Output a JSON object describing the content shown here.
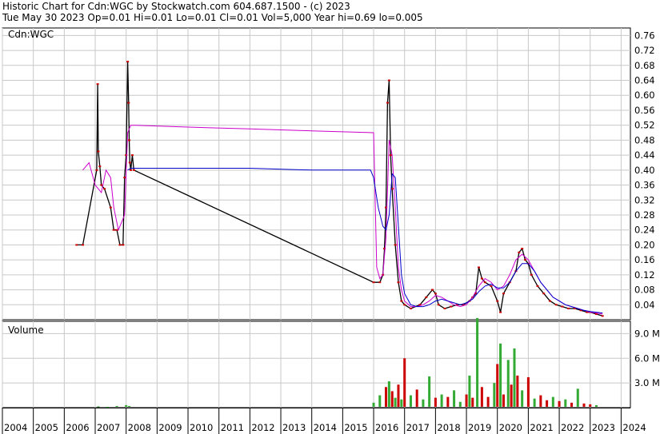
{
  "header": {
    "line1": "Historic Chart for Cdn:WGC by Stockwatch.com 604.687.1500 - (c) 2023",
    "line2": "Tue May 30 2023  Op=0.01  Hi=0.01  Lo=0.01  Cl=0.01  Vol=5,000  Year hi=0.69  lo=0.005"
  },
  "colors": {
    "price": "#000000",
    "price_marker": "#cc0000",
    "ma_short": "#cc00cc",
    "ma_long": "#0000cc",
    "volume_up": "#33aa33",
    "volume_down": "#cc0000",
    "grid": "#c8c8c8"
  },
  "chart_data": [
    {
      "type": "line",
      "symbol_label": "Cdn:WGC",
      "y_ticks": [
        "0.76",
        "0.72",
        "0.68",
        "0.64",
        "0.60",
        "0.56",
        "0.52",
        "0.48",
        "0.44",
        "0.40",
        "0.36",
        "0.32",
        "0.28",
        "0.24",
        "0.20",
        "0.16",
        "0.12",
        "0.08",
        "0.04"
      ],
      "ylim": [
        0,
        0.78
      ],
      "x_ticks": [
        "2004",
        "2005",
        "2006",
        "2007",
        "2008",
        "2009",
        "2010",
        "2011",
        "2012",
        "2013",
        "2014",
        "2015",
        "2016",
        "2017",
        "2018",
        "2019",
        "2020",
        "2021",
        "2022",
        "2023",
        "2024"
      ],
      "xlim": [
        2004.0,
        2024.3
      ],
      "grid": true,
      "series": [
        {
          "key": "price",
          "x": [
            2006.4,
            2006.6,
            2007.05,
            2007.08,
            2007.1,
            2007.15,
            2007.2,
            2007.3,
            2007.5,
            2007.6,
            2007.7,
            2007.8,
            2007.9,
            2007.95,
            2008.0,
            2008.05,
            2008.08,
            2008.1,
            2008.12,
            2008.15,
            2008.2,
            2008.25,
            2016.0,
            2016.2,
            2016.3,
            2016.35,
            2016.4,
            2016.45,
            2016.5,
            2016.55,
            2016.6,
            2016.7,
            2016.8,
            2016.9,
            2017.0,
            2017.2,
            2017.5,
            2017.7,
            2017.9,
            2018.0,
            2018.1,
            2018.3,
            2018.5,
            2018.7,
            2018.9,
            2019.1,
            2019.2,
            2019.3,
            2019.4,
            2019.5,
            2019.6,
            2019.8,
            2020.0,
            2020.1,
            2020.2,
            2020.4,
            2020.6,
            2020.7,
            2020.8,
            2020.9,
            2021.0,
            2021.1,
            2021.3,
            2021.5,
            2021.7,
            2021.9,
            2022.1,
            2022.3,
            2022.5,
            2022.7,
            2022.9,
            2023.0,
            2023.2,
            2023.4
          ],
          "y": [
            0.2,
            0.2,
            0.4,
            0.63,
            0.45,
            0.41,
            0.36,
            0.35,
            0.3,
            0.24,
            0.24,
            0.2,
            0.2,
            0.38,
            0.44,
            0.69,
            0.58,
            0.48,
            0.42,
            0.4,
            0.44,
            0.4,
            0.1,
            0.1,
            0.12,
            0.19,
            0.3,
            0.58,
            0.64,
            0.44,
            0.35,
            0.2,
            0.1,
            0.05,
            0.04,
            0.03,
            0.04,
            0.06,
            0.08,
            0.07,
            0.04,
            0.03,
            0.035,
            0.04,
            0.04,
            0.05,
            0.06,
            0.07,
            0.14,
            0.11,
            0.1,
            0.09,
            0.05,
            0.02,
            0.07,
            0.1,
            0.13,
            0.18,
            0.19,
            0.16,
            0.15,
            0.12,
            0.09,
            0.07,
            0.05,
            0.04,
            0.035,
            0.03,
            0.03,
            0.025,
            0.02,
            0.02,
            0.015,
            0.01
          ]
        },
        {
          "key": "ma_short",
          "x": [
            2006.6,
            2006.8,
            2007.0,
            2007.2,
            2007.35,
            2007.5,
            2007.6,
            2007.75,
            2007.85,
            2007.95,
            2008.05,
            2008.15,
            2008.3,
            2010.0,
            2012.0,
            2014.0,
            2016.0,
            2016.1,
            2016.2,
            2016.3,
            2016.4,
            2016.5,
            2016.6,
            2016.7,
            2016.8,
            2016.9,
            2017.0,
            2017.2,
            2017.4,
            2017.6,
            2017.8,
            2018.0,
            2018.2,
            2018.4,
            2018.6,
            2018.8,
            2019.0,
            2019.2,
            2019.4,
            2019.6,
            2019.8,
            2020.0,
            2020.2,
            2020.4,
            2020.6,
            2020.8,
            2021.0,
            2021.2,
            2021.4,
            2021.6,
            2021.8,
            2022.0,
            2022.2,
            2022.4,
            2022.6,
            2022.8,
            2023.0,
            2023.2,
            2023.4
          ],
          "y": [
            0.4,
            0.42,
            0.36,
            0.34,
            0.4,
            0.38,
            0.3,
            0.24,
            0.26,
            0.28,
            0.5,
            0.52,
            0.52,
            0.515,
            0.51,
            0.505,
            0.5,
            0.14,
            0.11,
            0.12,
            0.22,
            0.48,
            0.44,
            0.3,
            0.14,
            0.08,
            0.05,
            0.035,
            0.035,
            0.04,
            0.05,
            0.065,
            0.06,
            0.05,
            0.04,
            0.035,
            0.04,
            0.06,
            0.09,
            0.11,
            0.1,
            0.08,
            0.09,
            0.12,
            0.16,
            0.175,
            0.16,
            0.13,
            0.1,
            0.08,
            0.06,
            0.05,
            0.04,
            0.035,
            0.03,
            0.025,
            0.02,
            0.018,
            0.015
          ]
        },
        {
          "key": "ma_long",
          "x": [
            2008.05,
            2008.15,
            2010.0,
            2012.0,
            2014.0,
            2015.9,
            2016.0,
            2016.15,
            2016.3,
            2016.4,
            2016.5,
            2016.6,
            2016.7,
            2016.8,
            2016.9,
            2017.0,
            2017.2,
            2017.4,
            2017.6,
            2017.8,
            2018.0,
            2018.2,
            2018.4,
            2018.6,
            2018.8,
            2019.0,
            2019.2,
            2019.4,
            2019.6,
            2019.8,
            2020.0,
            2020.2,
            2020.4,
            2020.6,
            2020.8,
            2021.0,
            2021.2,
            2021.4,
            2021.6,
            2021.8,
            2022.0,
            2022.2,
            2022.4,
            2022.6,
            2022.8,
            2023.0,
            2023.2,
            2023.4
          ],
          "y": [
            0.4,
            0.405,
            0.405,
            0.405,
            0.4,
            0.4,
            0.38,
            0.3,
            0.25,
            0.24,
            0.28,
            0.39,
            0.38,
            0.25,
            0.12,
            0.07,
            0.04,
            0.035,
            0.035,
            0.04,
            0.05,
            0.055,
            0.05,
            0.045,
            0.04,
            0.045,
            0.055,
            0.075,
            0.09,
            0.095,
            0.085,
            0.085,
            0.1,
            0.13,
            0.15,
            0.15,
            0.13,
            0.1,
            0.08,
            0.06,
            0.05,
            0.04,
            0.035,
            0.03,
            0.025,
            0.022,
            0.02,
            0.018
          ]
        }
      ]
    },
    {
      "type": "bar",
      "title": "Volume",
      "y_ticks": [
        "9.0 M",
        "6.0 M",
        "3.0 M"
      ],
      "ylim": [
        0,
        10.5
      ],
      "xlim": [
        2004.0,
        2024.3
      ],
      "grid": true,
      "bars": {
        "x": [
          2007.1,
          2007.4,
          2007.7,
          2008.0,
          2008.1,
          2016.0,
          2016.2,
          2016.4,
          2016.5,
          2016.6,
          2016.7,
          2016.8,
          2016.9,
          2017.0,
          2017.2,
          2017.4,
          2017.6,
          2017.8,
          2018.0,
          2018.2,
          2018.4,
          2018.6,
          2018.8,
          2019.0,
          2019.1,
          2019.2,
          2019.35,
          2019.5,
          2019.7,
          2019.9,
          2020.0,
          2020.1,
          2020.2,
          2020.35,
          2020.45,
          2020.55,
          2020.65,
          2020.8,
          2021.0,
          2021.2,
          2021.4,
          2021.6,
          2021.8,
          2022.0,
          2022.2,
          2022.4,
          2022.6,
          2022.8,
          2023.0,
          2023.2
        ],
        "values": [
          0.15,
          0.1,
          0.2,
          0.3,
          0.2,
          0.6,
          1.5,
          2.5,
          3.2,
          2.0,
          1.2,
          2.8,
          1.0,
          6.0,
          1.5,
          2.2,
          1.0,
          3.8,
          1.2,
          1.6,
          1.3,
          2.1,
          0.7,
          1.6,
          3.9,
          1.2,
          10.9,
          2.5,
          1.3,
          3.0,
          5.3,
          7.8,
          1.6,
          5.8,
          2.8,
          7.2,
          3.9,
          2.1,
          3.7,
          1.1,
          1.5,
          0.9,
          1.3,
          0.8,
          1.0,
          0.6,
          2.3,
          0.5,
          0.4,
          0.3
        ],
        "up": [
          true,
          true,
          true,
          true,
          true,
          true,
          true,
          false,
          true,
          false,
          true,
          false,
          true,
          false,
          true,
          false,
          true,
          true,
          false,
          true,
          false,
          true,
          true,
          false,
          true,
          false,
          true,
          false,
          false,
          true,
          false,
          true,
          false,
          true,
          false,
          true,
          false,
          true,
          false,
          true,
          false,
          false,
          true,
          false,
          true,
          false,
          true,
          false,
          false,
          true
        ]
      }
    }
  ]
}
